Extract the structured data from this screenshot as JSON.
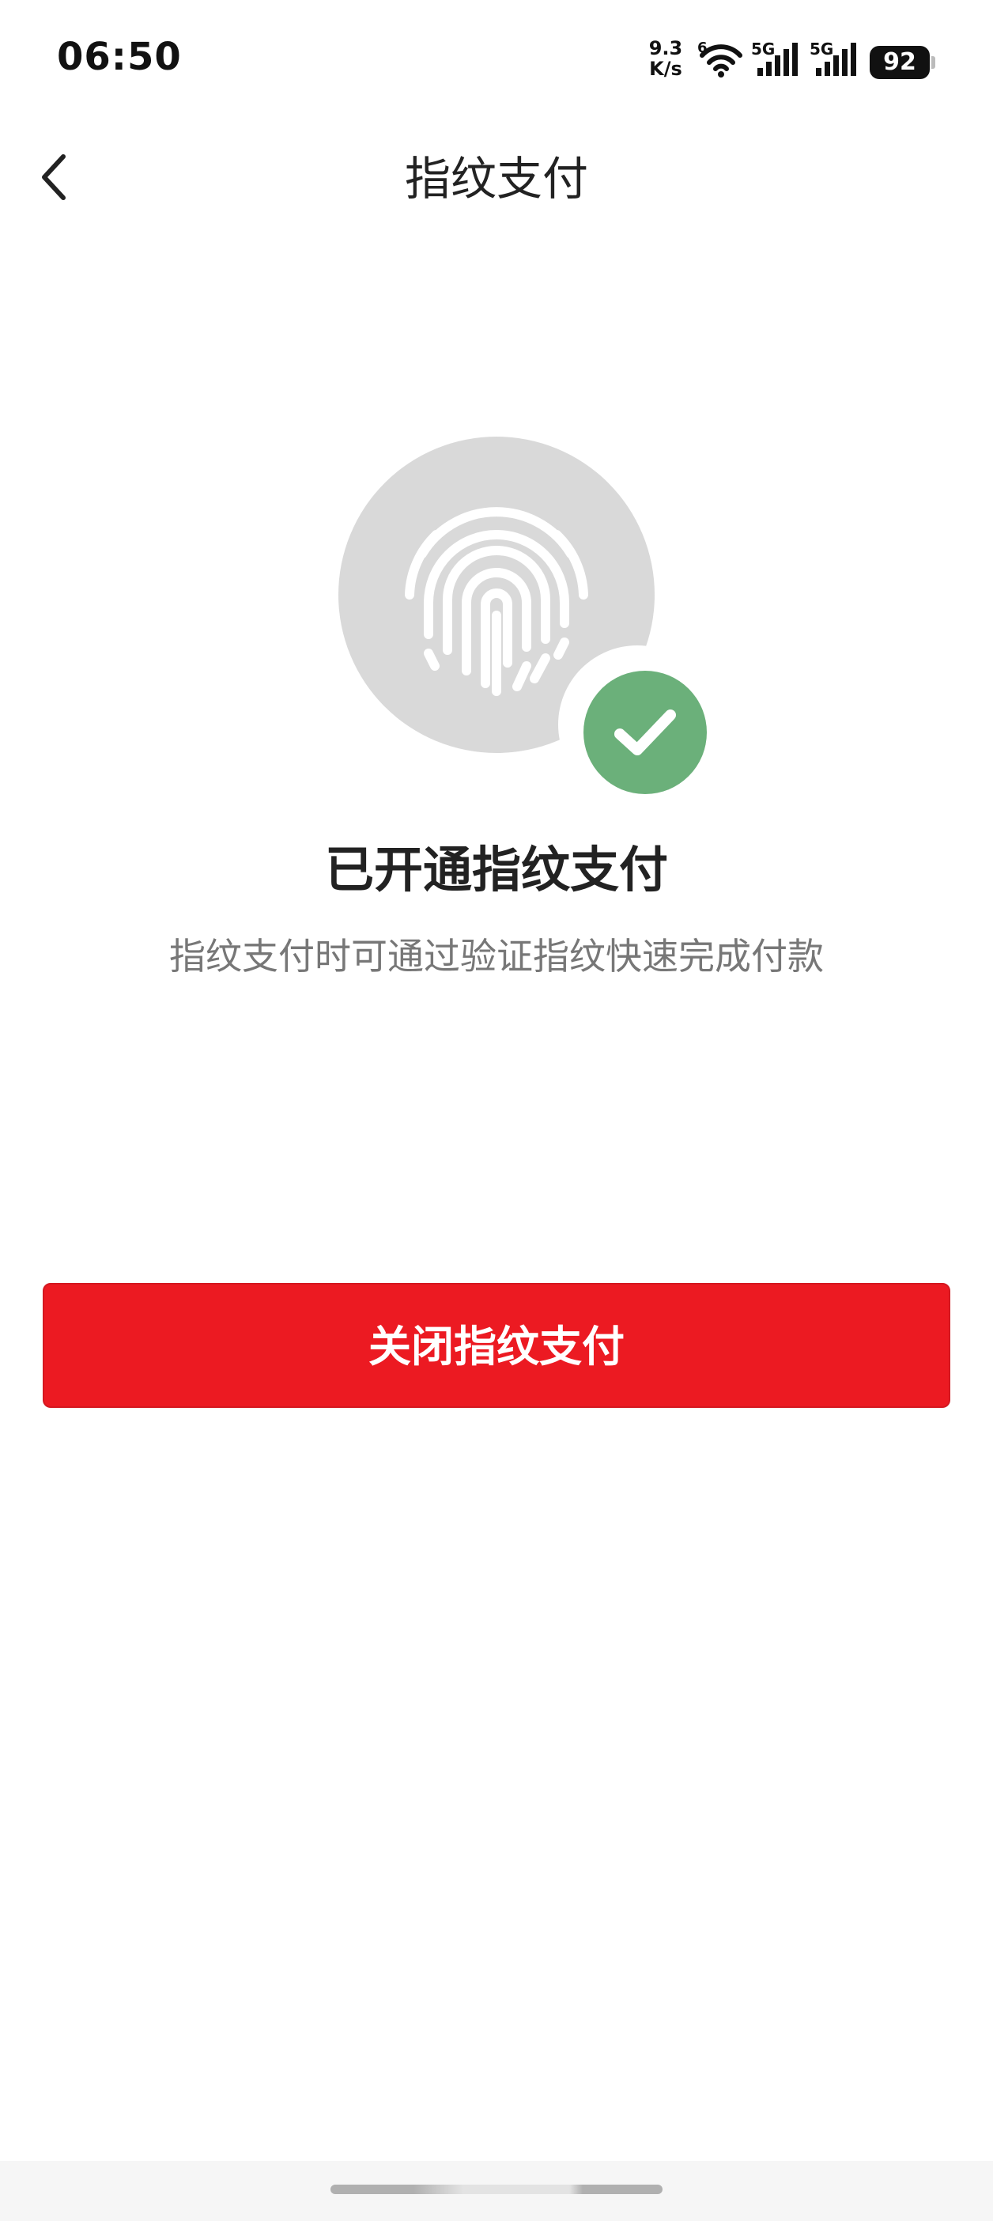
{
  "status_bar": {
    "time": "06:50",
    "net_speed_value": "9.3",
    "net_speed_unit": "K/s",
    "wifi_label": "6",
    "signal1_label": "5G",
    "signal2_label": "5G",
    "battery": "92"
  },
  "nav": {
    "back_icon": "chevron-left-icon",
    "title": "指纹支付"
  },
  "illustration": {
    "fingerprint_icon": "fingerprint-icon",
    "check_icon": "check-circle-icon",
    "circle_color": "#d9d9d9",
    "check_color": "#6bb07a"
  },
  "main": {
    "status_title": "已开通指纹支付",
    "status_desc": "指纹支付时可通过验证指纹快速完成付款"
  },
  "actions": {
    "close_button_label": "关闭指纹支付",
    "close_button_color": "#ec1a22"
  }
}
